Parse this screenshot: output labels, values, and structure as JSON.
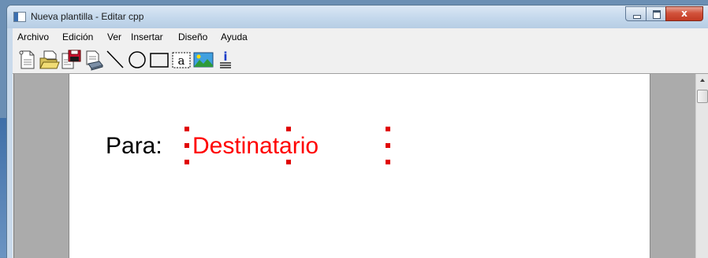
{
  "window": {
    "title": "Nueva plantilla - Editar cpp",
    "close_glyph": "x"
  },
  "menu": {
    "items": [
      "Archivo",
      "Edición",
      "Ver",
      "Insertar",
      "Diseño",
      "Ayuda"
    ]
  },
  "toolbar": {
    "tools": [
      "new-document-icon",
      "open-folder-icon",
      "save-disk-icon",
      "print-preview-icon",
      "line-tool-icon",
      "ellipse-tool-icon",
      "rectangle-tool-icon",
      "text-box-tool-icon",
      "image-tool-icon",
      "info-field-tool-icon"
    ],
    "text_tool_glyph": "a",
    "info_tool_glyph": "i"
  },
  "document": {
    "label": "Para:",
    "field": "Destinatario"
  },
  "colors": {
    "field_text": "#ff0000",
    "selection_handle": "#e00000",
    "page": "#ffffff",
    "workspace": "#ababab"
  }
}
